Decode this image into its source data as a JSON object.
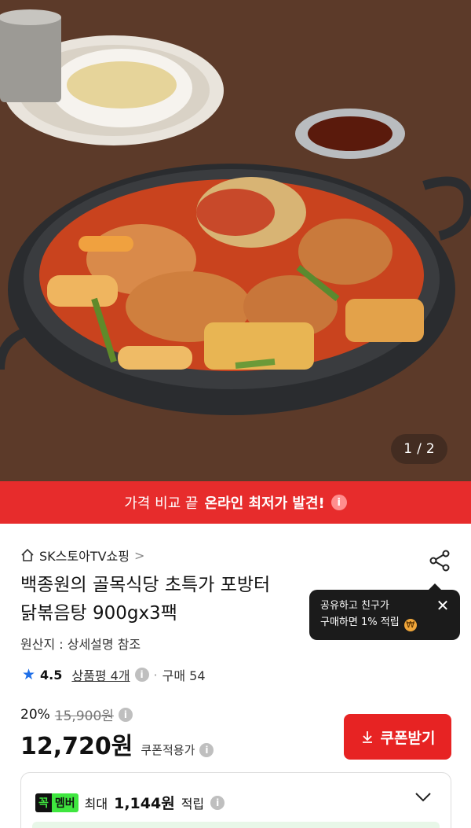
{
  "image": {
    "counter_current": "1",
    "counter_sep": "/",
    "counter_total": "2"
  },
  "promo": {
    "prefix": "가격 비교 끝",
    "highlight": "온라인 최저가 발견!",
    "info_icon": "info-icon"
  },
  "seller": {
    "name": "SK스토아TV쇼핑",
    "chevron": ">"
  },
  "product": {
    "title_line1": "백종원의 골목식당 초특가 포방터",
    "title_line2": "닭볶음탕 900gx3팩",
    "origin": "원산지 : 상세설명 참조"
  },
  "share_tooltip": {
    "line1": "공유하고 친구가",
    "line2": "구매하면 1% 적립",
    "close": "✕"
  },
  "rating": {
    "score": "4.5",
    "reviews": "상품평 4개",
    "separator": "·",
    "sold": "구매 54"
  },
  "price": {
    "discount": "20%",
    "original": "15,900원",
    "final": "12,720원",
    "final_label": "쿠폰적용가"
  },
  "coupon_button": {
    "label": "쿠폰받기"
  },
  "member": {
    "badge_part1": "꼭",
    "badge_part2": "멤버",
    "prefix": "최대",
    "amount": "1,144원",
    "suffix": "적립"
  },
  "colors": {
    "accent_red": "#e72c2c",
    "star_blue": "#1f6fe8",
    "member_green": "#3fe63f"
  }
}
